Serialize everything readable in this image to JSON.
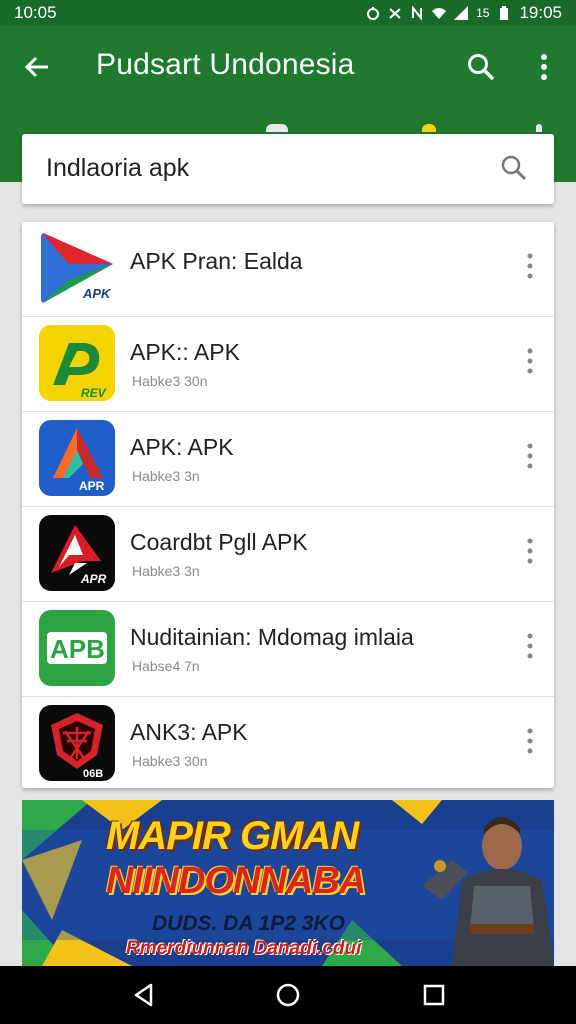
{
  "status_bar": {
    "time_left": "10:05",
    "time_right": "19:05",
    "signal_text": "15"
  },
  "app_bar": {
    "title": "Pudsart Undonesia",
    "back_icon": "back-arrow-icon",
    "search_icon": "search-icon",
    "more_icon": "more-vert-icon"
  },
  "search": {
    "value": "Indlaoria apk",
    "icon": "search-icon"
  },
  "apps": [
    {
      "name": "APK Pran: Ealda",
      "sub": "",
      "icon": "play-apk-icon",
      "icon_text": "APK"
    },
    {
      "name": "APK:: APK",
      "sub": "Habke3 30n",
      "icon": "yellow-apk-icon",
      "icon_text": "REV"
    },
    {
      "name": "APK: APK",
      "sub": "Habke3 3n",
      "icon": "blue-apk-icon",
      "icon_text": "APR"
    },
    {
      "name": "Coardbt Pgll APK",
      "sub": "Habke3 3n",
      "icon": "black-apk-icon",
      "icon_text": "APR"
    },
    {
      "name": "Nuditainian: Mdomag imlaia",
      "sub": "Habse4 7n",
      "icon": "green-apk-icon",
      "icon_text": "APB"
    },
    {
      "name": "ANK3: APK",
      "sub": "Habke3 30n",
      "icon": "red-shield-icon",
      "icon_text": "06B"
    }
  ],
  "banner": {
    "line1": "MAPIR GMAN",
    "line2": "NIINDONNABA",
    "line3": "DUDS. DA 1P2 3KO",
    "line4": "Rmerdiunnan Danadi.cdui"
  },
  "nav": {
    "back": "nav-back-icon",
    "home": "nav-home-icon",
    "recents": "nav-recents-icon"
  },
  "colors": {
    "app_bar": "#1f7a2f",
    "status_bar": "#1a6b2a",
    "background": "#e4e4e4"
  }
}
